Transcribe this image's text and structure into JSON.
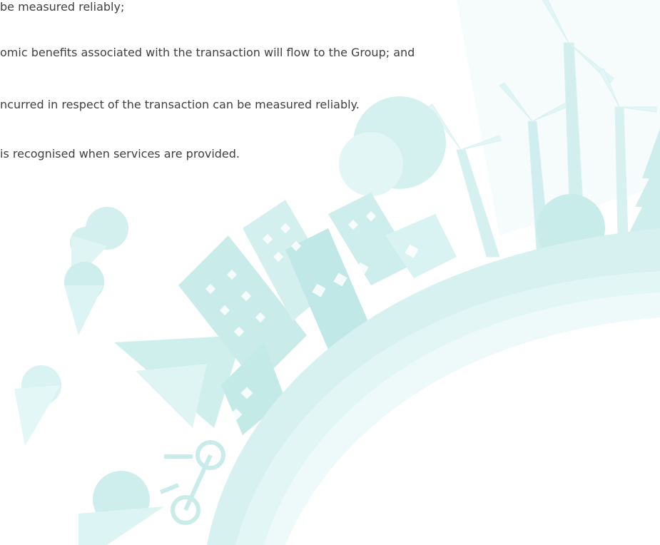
{
  "document": {
    "lines": [
      "be measured reliably;",
      "omic benefits associated with the transaction will flow to the Group; and",
      "ncurred in respect of the transaction can be measured reliably.",
      " is recognised when services are provided."
    ]
  },
  "illustration": {
    "colors": {
      "light": "#e8f7f6",
      "mid": "#d4f1ef",
      "strong": "#bfeae8",
      "deep": "#aee3e1"
    }
  }
}
